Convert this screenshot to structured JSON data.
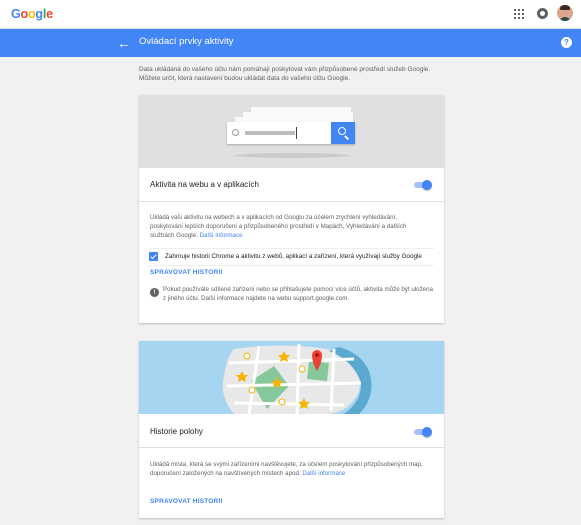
{
  "topbar": {
    "logo_letters": [
      "G",
      "o",
      "o",
      "g",
      "l",
      "e"
    ],
    "apps_icon": "apps-grid-icon",
    "notifications_icon": "notifications-icon",
    "avatar": "account-avatar"
  },
  "appbar": {
    "back_icon": "arrow-back-icon",
    "title": "Ovládací prvky aktivity",
    "help_icon": "help-icon",
    "color": "#4285f4"
  },
  "intro": "Data ukládaná do vašeho účtu nám pomáhají poskytovat vám přizpůsobené prostředí služeb Google. Můžete určit, která nastavení budou ukládat data do vašeho účtu Google.",
  "web_activity": {
    "title": "Aktivita na webu a v aplikacích",
    "enabled": true,
    "description": "Ukládá vaši aktivitu na webech a v aplikacích od Googlu za účelem zrychlení vyhledávání, poskytování lepších doporučení a přizpůsobeného prostředí v Mapách, Vyhledávání a dalších službách Google.",
    "more_info": "Další informace",
    "checkbox_label": "Zahrnuje historii Chrome a aktivitu z webů, aplikací a zařízení, která využívají služby Google",
    "checkbox_checked": true,
    "manage_history": "SPRAVOVAT HISTORII",
    "notice": "Pokud používáte sdílené zařízení nebo se přihlašujete pomocí více účtů, aktivita může být uložena z jiného účtu. Další informace najdete na webu support.google.com."
  },
  "location_history": {
    "title": "Historie polohy",
    "enabled": true,
    "description": "Ukládá místa, která se svými zařízeními navštěvujete, za účelem poskytování přizpůsobených map, doporučení založených na navštívených místech apod.",
    "more_info": "Další informace",
    "manage_history": "SPRAVOVAT HISTORII"
  },
  "colors": {
    "accent": "#4285f4",
    "map_water": "#a5d5f0",
    "map_land": "#e8e8e8",
    "map_park": "#86c89a",
    "map_pin": "#ea4335",
    "map_star": "#f5b400"
  }
}
